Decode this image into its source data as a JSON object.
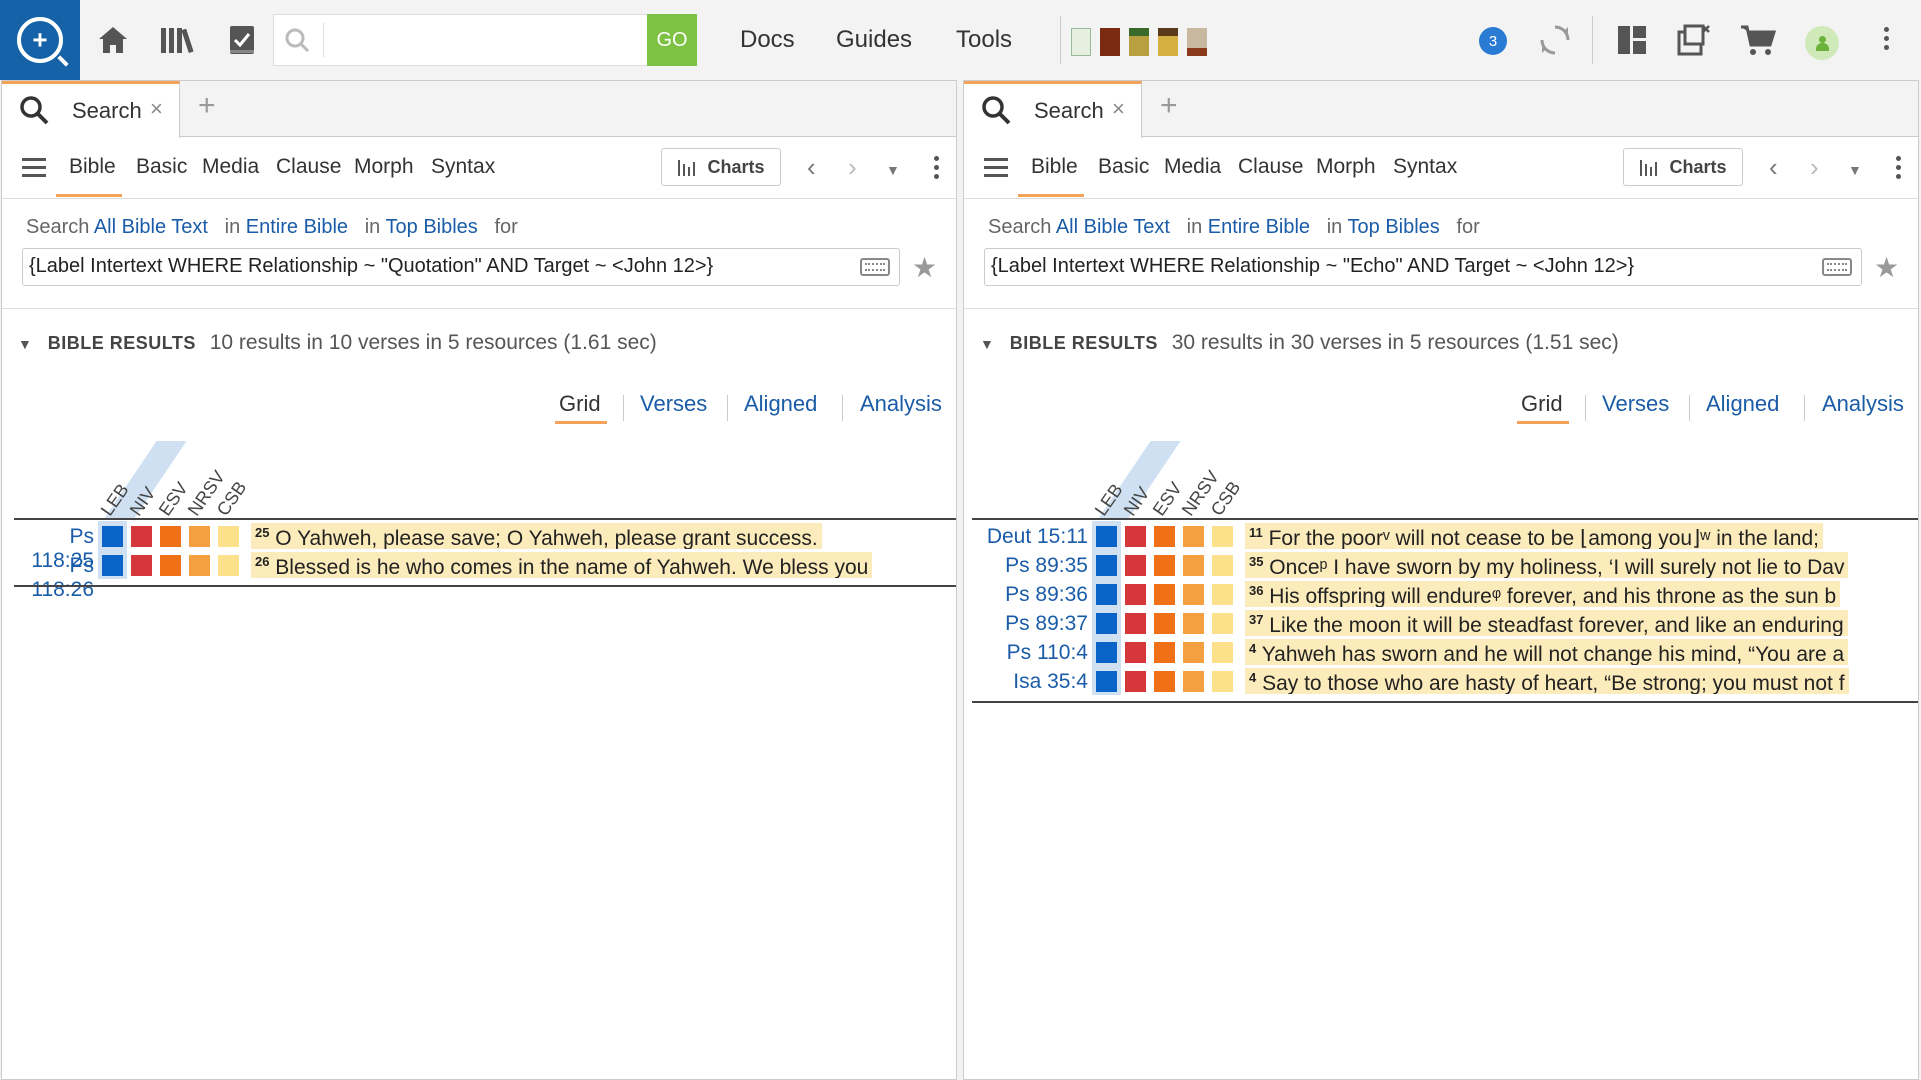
{
  "toolbar": {
    "search_placeholder": "",
    "go_label": "GO",
    "nav": [
      "Docs",
      "Guides",
      "Tools"
    ],
    "notification_count": "3",
    "book_colors": [
      "#5a8a3a",
      "#8a3a1a",
      "#c08a20",
      "#d0a030",
      "#8a6a3a"
    ]
  },
  "colors": {
    "accent": "#f4a259",
    "link": "#1a5ca8",
    "go": "#7dc242",
    "highlight": "#fcebbb",
    "col_leb": "#0a64c8",
    "col_niv": "#d6373a",
    "col_esv": "#f07018",
    "col_nrsv": "#f5a040",
    "col_csb": "#fde08a"
  },
  "panels": [
    {
      "tab_label": "Search",
      "sub_tabs": [
        "Bible",
        "Basic",
        "Media",
        "Clause",
        "Morph",
        "Syntax"
      ],
      "charts_label": "Charts",
      "search_prefix": "Search",
      "scope1": "All Bible Text",
      "in1": "in",
      "scope2": "Entire Bible",
      "in2": "in",
      "scope3": "Top Bibles",
      "for_word": "for",
      "query": "{Label Intertext WHERE Relationship ~ \"Quotation\" AND Target ~ <John 12>}",
      "results_caption": "BIBLE RESULTS",
      "results_summary": "10 results in 10 verses in 5 resources (1.61 sec)",
      "views": [
        "Grid",
        "Verses",
        "Aligned",
        "Analysis"
      ],
      "columns": [
        "LEB",
        "NIV",
        "ESV",
        "NRSV",
        "CSB"
      ],
      "rows": [
        {
          "ref": "Ps 118:25",
          "num": "25",
          "text": "O Yahweh, please save; O Yahweh, please grant success."
        },
        {
          "ref": "Ps 118:26",
          "num": "26",
          "text": "Blessed is he who comes in the name of Yahweh. We bless you"
        }
      ]
    },
    {
      "tab_label": "Search",
      "sub_tabs": [
        "Bible",
        "Basic",
        "Media",
        "Clause",
        "Morph",
        "Syntax"
      ],
      "charts_label": "Charts",
      "search_prefix": "Search",
      "scope1": "All Bible Text",
      "in1": "in",
      "scope2": "Entire Bible",
      "in2": "in",
      "scope3": "Top Bibles",
      "for_word": "for",
      "query": "{Label Intertext WHERE Relationship ~ \"Echo\" AND Target ~ <John 12>}",
      "results_caption": "BIBLE RESULTS",
      "results_summary": "30 results in 30 verses in 5 resources (1.51 sec)",
      "views": [
        "Grid",
        "Verses",
        "Aligned",
        "Analysis"
      ],
      "columns": [
        "LEB",
        "NIV",
        "ESV",
        "NRSV",
        "CSB"
      ],
      "rows": [
        {
          "ref": "Deut 15:11",
          "num": "11",
          "text": "For the poorᵛ will not cease to be ⌊among you⌋ʷ in the land;"
        },
        {
          "ref": "Ps 89:35",
          "num": "35",
          "text": "Onceᵖ I have sworn by my holiness, ‘I will surely not lie to Dav"
        },
        {
          "ref": "Ps 89:36",
          "num": "36",
          "text": "His offspring will endureᵠ forever, and his throne as the sun b"
        },
        {
          "ref": "Ps 89:37",
          "num": "37",
          "text": "Like the moon it will be steadfast forever, and like an enduring"
        },
        {
          "ref": "Ps 110:4",
          "num": "4",
          "text": "Yahweh has sworn and he will not change his mind, “You are a"
        },
        {
          "ref": "Isa 35:4",
          "num": "4",
          "text": "Say to those who are hasty of heart, “Be strong; you must not f"
        }
      ]
    }
  ]
}
